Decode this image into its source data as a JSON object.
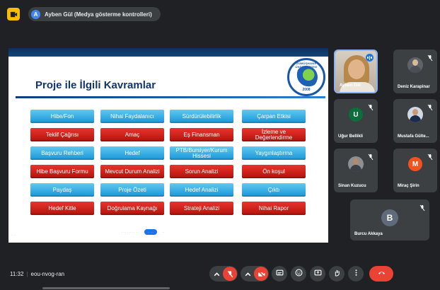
{
  "topbar": {
    "presenter_initial": "A",
    "presenter_label": "Ayben Gül (Medya gösterme kontrolleri)"
  },
  "slide": {
    "title": "Proje ile İlgili Kavramlar",
    "logo_text": "GÜMÜŞHANE ÜNİVERSİTESİ",
    "logo_year": "2008",
    "tiles": [
      {
        "label": "Hibe/Fon",
        "color": "blue"
      },
      {
        "label": "Nihai Faydalanıcı",
        "color": "blue"
      },
      {
        "label": "Sürdürülebilirlik",
        "color": "blue"
      },
      {
        "label": "Çarpan Etkisi",
        "color": "blue"
      },
      {
        "label": "Teklif Çağrısı",
        "color": "red"
      },
      {
        "label": "Amaç",
        "color": "red"
      },
      {
        "label": "Eş Finansman",
        "color": "red"
      },
      {
        "label": "İzleme ve Değerlendirme",
        "color": "red"
      },
      {
        "label": "Başvuru Rehberi",
        "color": "blue"
      },
      {
        "label": "Hedef",
        "color": "blue"
      },
      {
        "label": "PTB/Bursiyer/Kurum Hissesi",
        "color": "blue"
      },
      {
        "label": "Yaygınlaştırma",
        "color": "blue"
      },
      {
        "label": "Hibe Başvuru Formu",
        "color": "red"
      },
      {
        "label": "Mevcut Durum Analizi",
        "color": "red"
      },
      {
        "label": "Sorun Analizi",
        "color": "red"
      },
      {
        "label": "Ön koşul",
        "color": "red"
      },
      {
        "label": "Paydaş",
        "color": "blue"
      },
      {
        "label": "Proje Özeti",
        "color": "blue"
      },
      {
        "label": "Hedef Analizi",
        "color": "blue"
      },
      {
        "label": "Çıktı",
        "color": "blue"
      },
      {
        "label": "Hedef Kitle",
        "color": "red"
      },
      {
        "label": "Doğrulama Kaynağı",
        "color": "red"
      },
      {
        "label": "Strateji Analizi",
        "color": "red"
      },
      {
        "label": "Nihai Rapor",
        "color": "red"
      }
    ]
  },
  "participants": [
    {
      "name": "Ayben Gül",
      "kind": "camera",
      "muted": false
    },
    {
      "name": "Deniz Karapinar",
      "kind": "photo",
      "muted": true
    },
    {
      "name": "Uğur Bellikli",
      "kind": "initial",
      "initial": "U",
      "avatar_color": "#0b6e3b",
      "muted": true
    },
    {
      "name": "Mustafa Gülte...",
      "kind": "photo",
      "muted": true
    },
    {
      "name": "Sinan Kuzucu",
      "kind": "photo",
      "muted": true
    },
    {
      "name": "Miraç Şirin",
      "kind": "initial",
      "initial": "M",
      "avatar_color": "#f4511e",
      "muted": true
    },
    {
      "name": "Burcu Akkaya",
      "kind": "initial",
      "initial": "B",
      "avatar_color": "#5f6b7a",
      "muted": true
    }
  ],
  "bottombar": {
    "time": "11:32",
    "meeting_code": "eou-nvog-ran"
  },
  "colors": {
    "tile_blue": "#1896d8",
    "tile_red": "#b3120c",
    "meet_red": "#ea4335",
    "background": "#202124"
  }
}
